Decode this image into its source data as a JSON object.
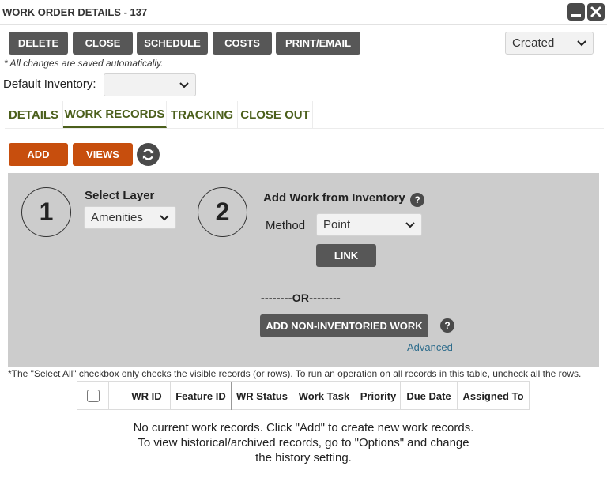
{
  "window": {
    "title": "WORK ORDER DETAILS - 137",
    "minimize_icon": "minimize-icon",
    "close_icon": "close-icon"
  },
  "toolbar": {
    "buttons": [
      "DELETE",
      "CLOSE",
      "SCHEDULE",
      "COSTS",
      "PRINT/EMAIL"
    ],
    "status_value": "Created"
  },
  "autosave_note": "* All changes are saved automatically.",
  "default_inventory": {
    "label": "Default Inventory:",
    "value": ""
  },
  "tabs": [
    {
      "label": "DETAILS",
      "active": false
    },
    {
      "label": "WORK RECORDS",
      "active": true
    },
    {
      "label": "TRACKING",
      "active": false
    },
    {
      "label": "CLOSE OUT",
      "active": false
    }
  ],
  "actions": {
    "add": "ADD",
    "views": "VIEWS",
    "refresh_icon": "refresh-icon"
  },
  "panel": {
    "step1": {
      "number": "1",
      "label": "Select Layer",
      "layer_value": "Amenities"
    },
    "step2": {
      "number": "2",
      "label": "Add Work from Inventory",
      "method_label": "Method",
      "method_value": "Point",
      "link_button": "LINK",
      "or_text": "--------OR--------",
      "non_inventoried_button": "ADD NON-INVENTORIED WORK",
      "advanced_link": "Advanced",
      "help_glyph": "?"
    }
  },
  "footnote": "*The \"Select All\" checkbox only checks the visible records (or rows). To run an operation on all records in this table, uncheck all the rows.",
  "table": {
    "columns": [
      "WR ID",
      "Feature ID",
      "WR Status",
      "Work Task",
      "Priority",
      "Due Date",
      "Assigned To"
    ]
  },
  "empty_state": {
    "line1": "No current work records. Click \"Add\" to create new work records.",
    "line2": "To view historical/archived records, go to \"Options\" and change",
    "line3": "the history setting."
  },
  "colors": {
    "accent_orange": "#c74e0d",
    "button_gray": "#575757",
    "tab_green": "#4b5f1b",
    "panel_gray": "#cccccc",
    "link_blue": "#2d6c8c"
  }
}
